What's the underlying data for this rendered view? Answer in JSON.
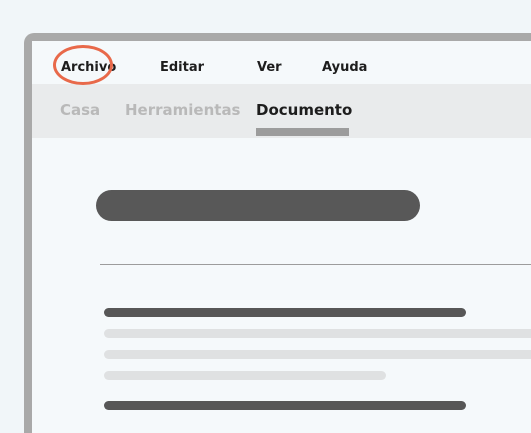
{
  "menubar": {
    "items": [
      {
        "label": "Archivo"
      },
      {
        "label": "Editar"
      },
      {
        "label": "Ver"
      },
      {
        "label": "Ayuda"
      }
    ]
  },
  "ribbon": {
    "tabs": [
      {
        "label": "Casa",
        "state": "inactive"
      },
      {
        "label": "Herramientas",
        "state": "inactive"
      },
      {
        "label": "Documento",
        "state": "active"
      }
    ]
  },
  "colors": {
    "highlight": "#e8694a",
    "window_frame": "#a9a9a9",
    "ribbon_bg": "#e9ebec",
    "text_placeholder_dark": "#575757",
    "text_placeholder_light": "#dfe1e2"
  }
}
